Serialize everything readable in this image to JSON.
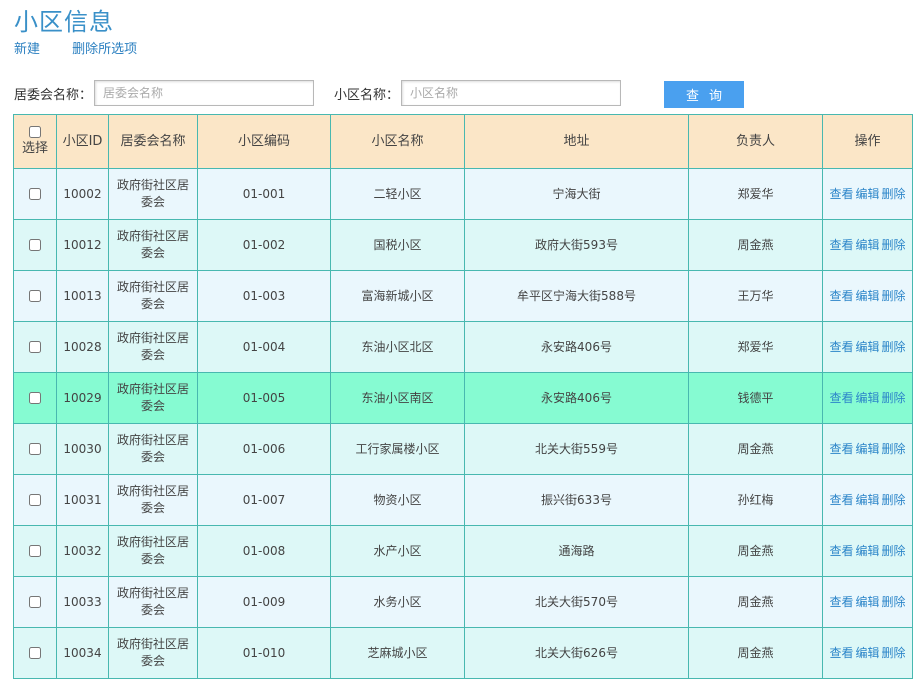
{
  "page": {
    "title": "小区信息"
  },
  "actions": {
    "new_label": "新建",
    "delete_selected_label": "删除所选项"
  },
  "search": {
    "committee_label": "居委会名称：",
    "committee_placeholder": "居委会名称",
    "community_label": "小区名称：",
    "community_placeholder": "小区名称",
    "query_label": "查询"
  },
  "table": {
    "headers": {
      "select": "选择",
      "id": "小区ID",
      "committee": "居委会名称",
      "code": "小区编码",
      "name": "小区名称",
      "address": "地址",
      "manager": "负责人",
      "ops": "操作"
    },
    "op_labels": {
      "view": "查看",
      "edit": "编辑",
      "delete": "删除"
    },
    "rows": [
      {
        "id": "10002",
        "committee": "政府街社区居委会",
        "code": "01-001",
        "name": "二轻小区",
        "address": "宁海大街",
        "manager": "郑爱华",
        "highlighted": false
      },
      {
        "id": "10012",
        "committee": "政府街社区居委会",
        "code": "01-002",
        "name": "国税小区",
        "address": "政府大街593号",
        "manager": "周金燕",
        "highlighted": false
      },
      {
        "id": "10013",
        "committee": "政府街社区居委会",
        "code": "01-003",
        "name": "富海新城小区",
        "address": "牟平区宁海大街588号",
        "manager": "王万华",
        "highlighted": false
      },
      {
        "id": "10028",
        "committee": "政府街社区居委会",
        "code": "01-004",
        "name": "东油小区北区",
        "address": "永安路406号",
        "manager": "郑爱华",
        "highlighted": false
      },
      {
        "id": "10029",
        "committee": "政府街社区居委会",
        "code": "01-005",
        "name": "东油小区南区",
        "address": "永安路406号",
        "manager": "钱德平",
        "highlighted": true
      },
      {
        "id": "10030",
        "committee": "政府街社区居委会",
        "code": "01-006",
        "name": "工行家属楼小区",
        "address": "北关大街559号",
        "manager": "周金燕",
        "highlighted": false
      },
      {
        "id": "10031",
        "committee": "政府街社区居委会",
        "code": "01-007",
        "name": "物资小区",
        "address": "振兴街633号",
        "manager": "孙红梅",
        "highlighted": false
      },
      {
        "id": "10032",
        "committee": "政府街社区居委会",
        "code": "01-008",
        "name": "水产小区",
        "address": "通海路",
        "manager": "周金燕",
        "highlighted": false
      },
      {
        "id": "10033",
        "committee": "政府街社区居委会",
        "code": "01-009",
        "name": "水务小区",
        "address": "北关大街570号",
        "manager": "周金燕",
        "highlighted": false
      },
      {
        "id": "10034",
        "committee": "政府街社区居委会",
        "code": "01-010",
        "name": "芝麻城小区",
        "address": "北关大街626号",
        "manager": "周金燕",
        "highlighted": false
      }
    ]
  },
  "colors": {
    "title": "#3a90c8",
    "link": "#2d86c9",
    "header_bg": "#fbe6c7",
    "row_odd_bg": "#eaf7fd",
    "row_even_bg": "#ddf8f7",
    "row_highlight_bg": "#86fbd2",
    "border": "#48b8b0",
    "query_button": "#4aa0ef"
  }
}
